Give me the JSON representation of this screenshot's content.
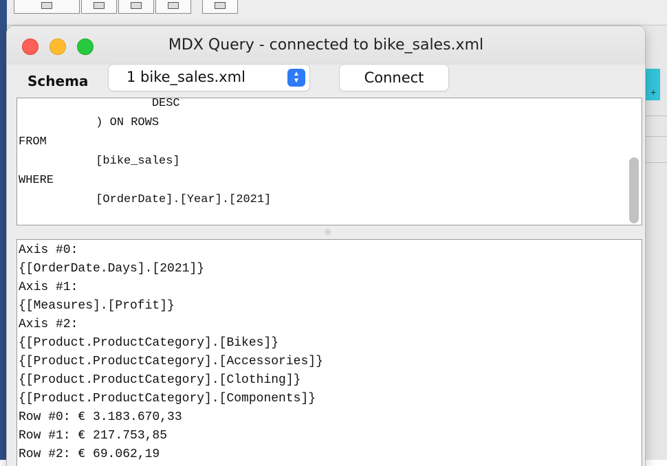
{
  "window": {
    "title": "MDX Query - connected to bike_sales.xml"
  },
  "schema": {
    "label": "Schema",
    "selected": "1 bike_sales.xml",
    "connect_label": "Connect"
  },
  "query": {
    "lines": [
      "                   DESC",
      "           ) ON ROWS",
      "FROM",
      "           [bike_sales]",
      "WHERE",
      "           [OrderDate].[Year].[2021]"
    ]
  },
  "result": {
    "lines": [
      "Axis #0:",
      "{[OrderDate.Days].[2021]}",
      "Axis #1:",
      "{[Measures].[Profit]}",
      "Axis #2:",
      "{[Product.ProductCategory].[Bikes]}",
      "{[Product.ProductCategory].[Accessories]}",
      "{[Product.ProductCategory].[Clothing]}",
      "{[Product.ProductCategory].[Components]}",
      "Row #0: € 3.183.670,33",
      "Row #1: € 217.753,85",
      "Row #2: € 69.062,19"
    ]
  },
  "icons": {
    "close": "close-window-icon",
    "minimize": "minimize-window-icon",
    "maximize": "zoom-window-icon",
    "stepper": "chevron-updown-icon"
  },
  "colors": {
    "close": "#fe5f57",
    "minimize": "#febc2e",
    "maximize": "#28c840",
    "stepper": "#2f7bf6",
    "accent_teal": "#33c4d8"
  }
}
